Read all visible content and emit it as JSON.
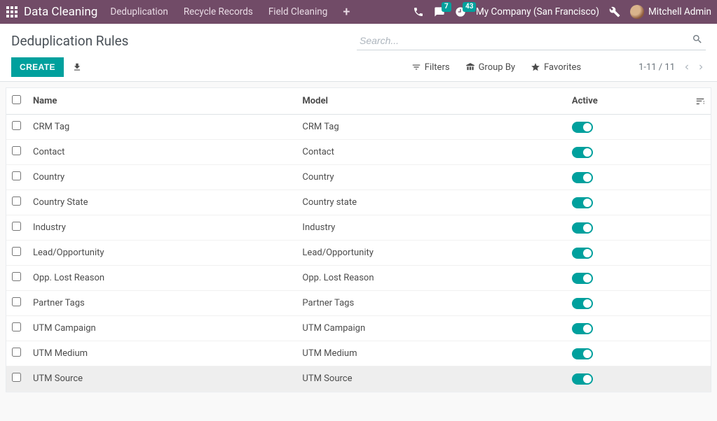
{
  "topnav": {
    "brand": "Data Cleaning",
    "menu": [
      "Deduplication",
      "Recycle Records",
      "Field Cleaning"
    ],
    "messages_badge": "7",
    "activities_badge": "43",
    "company": "My Company (San Francisco)",
    "user": "Mitchell Admin"
  },
  "control": {
    "title": "Deduplication Rules",
    "create_label": "CREATE",
    "search_placeholder": "Search...",
    "filters_label": "Filters",
    "groupby_label": "Group By",
    "favorites_label": "Favorites",
    "pager": "1-11 / 11"
  },
  "table": {
    "headers": {
      "name": "Name",
      "model": "Model",
      "active": "Active"
    },
    "rows": [
      {
        "name": "CRM Tag",
        "model": "CRM Tag",
        "active": true
      },
      {
        "name": "Contact",
        "model": "Contact",
        "active": true
      },
      {
        "name": "Country",
        "model": "Country",
        "active": true
      },
      {
        "name": "Country State",
        "model": "Country state",
        "active": true
      },
      {
        "name": "Industry",
        "model": "Industry",
        "active": true
      },
      {
        "name": "Lead/Opportunity",
        "model": "Lead/Opportunity",
        "active": true
      },
      {
        "name": "Opp. Lost Reason",
        "model": "Opp. Lost Reason",
        "active": true
      },
      {
        "name": "Partner Tags",
        "model": "Partner Tags",
        "active": true
      },
      {
        "name": "UTM Campaign",
        "model": "UTM Campaign",
        "active": true
      },
      {
        "name": "UTM Medium",
        "model": "UTM Medium",
        "active": true
      },
      {
        "name": "UTM Source",
        "model": "UTM Source",
        "active": true
      }
    ],
    "highlight_index": 10
  }
}
